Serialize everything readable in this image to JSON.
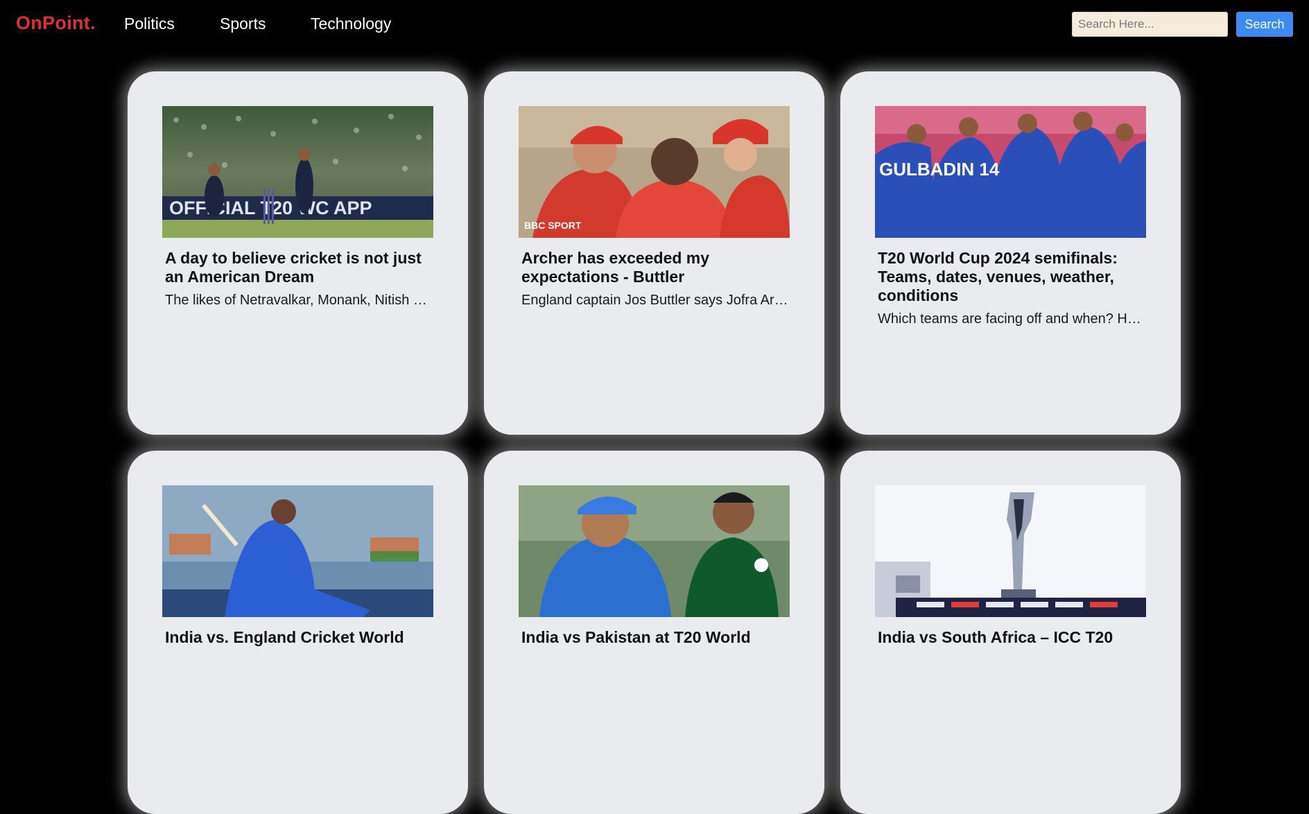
{
  "nav": {
    "brand": "OnPoint.",
    "links": [
      "Politics",
      "Sports",
      "Technology"
    ],
    "search_placeholder": "Search Here...",
    "search_button": "Search"
  },
  "cards": [
    {
      "title": "A day to believe cricket is not just an American Dream",
      "description": "The likes of Netravalkar, Monank, Nitish Kumar, and Aaron Jones",
      "image": "usa-cricket-celebration-photo",
      "image_text": "OFFICIAL T20 WC APP"
    },
    {
      "title": "Archer has exceeded my expectations - Buttler",
      "description": "England captain Jos Buttler says Jofra Archer has exceeded",
      "image": "england-players-photo",
      "image_text": "BBC SPORT"
    },
    {
      "title": "T20 World Cup 2024 semifinals: Teams, dates, venues, weather, conditions",
      "description": "Which teams are facing off and when? Here is everything",
      "image": "afghanistan-team-huddle-photo",
      "image_text": "GULBADIN 14"
    },
    {
      "title": "India vs. England Cricket World",
      "description": "",
      "image": "india-batter-photo",
      "image_text": ""
    },
    {
      "title": "India vs Pakistan at T20 World",
      "description": "",
      "image": "india-pakistan-captains-photo",
      "image_text": ""
    },
    {
      "title": "India vs South Africa – ICC T20",
      "description": "",
      "image": "t20-trophy-photo",
      "image_text": ""
    }
  ]
}
